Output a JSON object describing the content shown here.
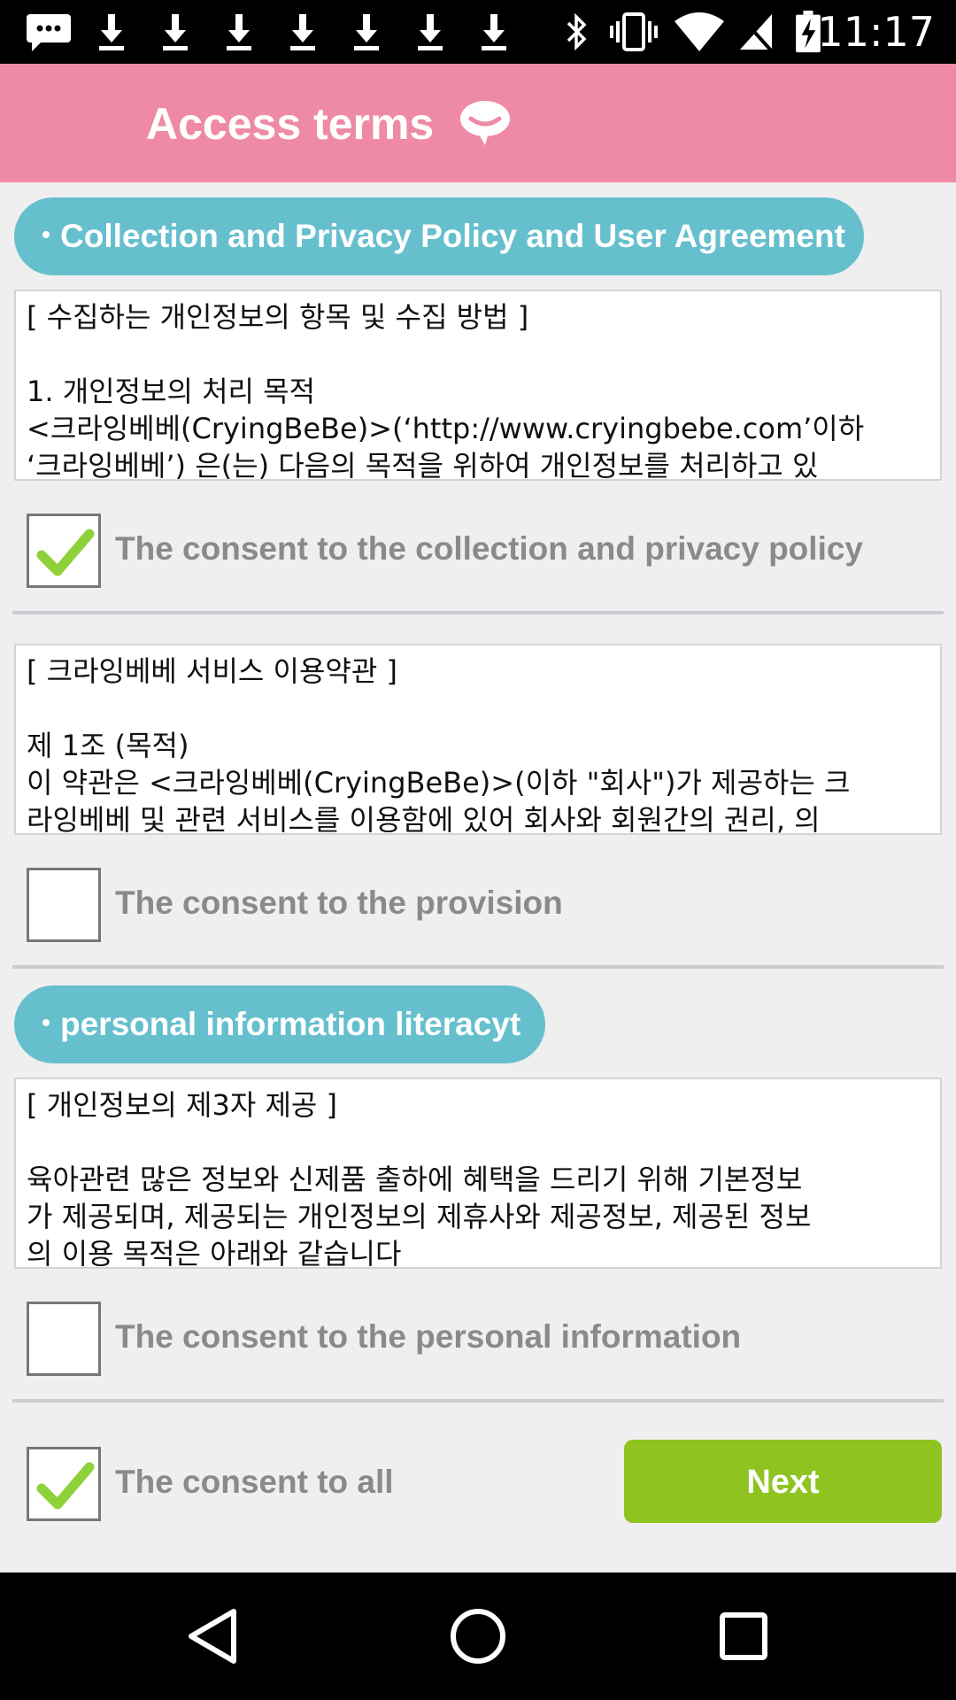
{
  "status_bar": {
    "time": "11:17",
    "icons": [
      "message-icon",
      "download-icon",
      "download-icon",
      "download-icon",
      "download-icon",
      "download-icon",
      "download-icon",
      "download-icon",
      "bluetooth-icon",
      "vibrate-icon",
      "wifi-icon",
      "no-sim-icon",
      "battery-charging-icon"
    ]
  },
  "header": {
    "title": "Access terms",
    "icon": "speech-bubble-icon"
  },
  "sections": {
    "privacy": {
      "heading": "Collection and Privacy Policy and User Agreement",
      "text_lines": [
        "[ 수집하는 개인정보의 항목 및 수집 방법 ]",
        "",
        "1. 개인정보의 처리 목적",
        "<크라잉베베(CryingBeBe)>(‘http://www.cryingbebe.com’이하",
        "‘크라잉베베’) 은(는) 다음의 목적을 위하여 개인정보를 처리하고 있"
      ],
      "consent_label": "The consent to the collection and privacy policy",
      "checked": true
    },
    "provision": {
      "text_lines": [
        "[ 크라잉베베 서비스 이용약관 ]",
        "",
        "제 1조 (목적)",
        "이 약관은 <크라잉베베(CryingBeBe)>(이하 \"회사\")가 제공하는 크",
        "라잉베베 및 관련 서비스를 이용함에 있어 회사와 회원간의 권리, 의"
      ],
      "consent_label": "The consent to the provision",
      "checked": false
    },
    "personal": {
      "heading": "personal information literacyt",
      "text_lines": [
        "[ 개인정보의 제3자 제공 ]",
        "",
        "육아관련 많은 정보와 신제품 출하에 혜택을 드리기 위해 기본정보",
        "가 제공되며, 제공되는 개인정보의 제휴사와 제공정보, 제공된 정보",
        "의 이용 목적은 아래와 같습니다"
      ],
      "consent_label": "The consent to the personal information",
      "checked": false
    }
  },
  "footer": {
    "consent_all_label": "The consent to all",
    "consent_all_checked": true,
    "next_label": "Next"
  },
  "colors": {
    "header_bg": "#ef8aa6",
    "pill_bg": "#66bfcd",
    "next_bg": "#8fc31f",
    "check_green": "#8fd13a"
  },
  "nav_bar": {
    "icons": [
      "back-icon",
      "home-icon",
      "recents-icon"
    ]
  }
}
